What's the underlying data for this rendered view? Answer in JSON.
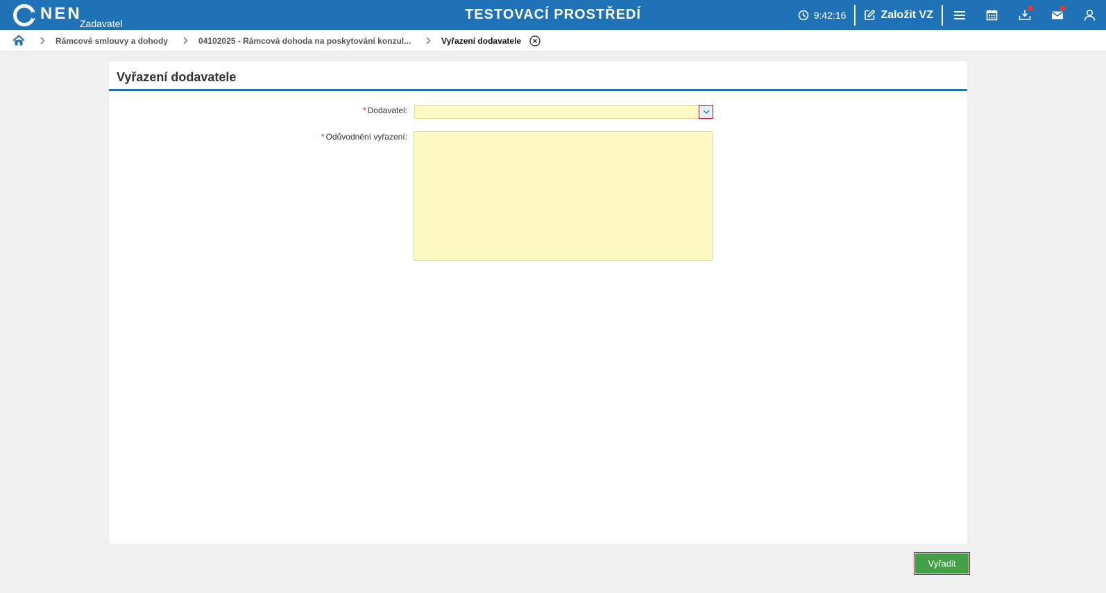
{
  "header": {
    "logo_text": "NEN",
    "logo_sub": "Zadavatel",
    "env_title": "TESTOVACÍ PROSTŘEDÍ",
    "clock": "9:42:16",
    "create_label": "Založit VZ",
    "icons": [
      "clock-icon",
      "edit-icon",
      "menu-icon",
      "calendar-icon",
      "download-icon",
      "mail-icon",
      "user-icon"
    ],
    "accent_color": "#1f72b5",
    "notification_color": "#e53935"
  },
  "breadcrumb": {
    "items": [
      "Rámcové smlouvy a dohody",
      "04102025 - Rámcová dohoda na poskytování konzul..."
    ],
    "current": "Vyřazení dodavatele"
  },
  "panel": {
    "title": "Vyřazení dodavatele"
  },
  "form": {
    "supplier": {
      "required_mark": "*",
      "label": "Dodavatel:",
      "value": ""
    },
    "reason": {
      "required_mark": "*",
      "label": "Odůvodnění vyřazení:",
      "value": ""
    },
    "field_color": "#fff9c4"
  },
  "actions": {
    "submit_label": "Vyřadit",
    "submit_color": "#43a047"
  }
}
